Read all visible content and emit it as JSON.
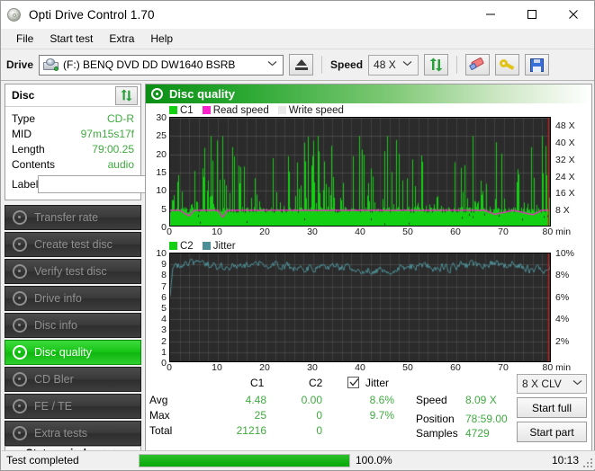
{
  "window": {
    "title": "Opti Drive Control 1.70",
    "icon": "disc-icon",
    "minimize_label": "–",
    "maximize_label": "□",
    "close_label": "✕"
  },
  "menu": {
    "items": [
      {
        "label": "File"
      },
      {
        "label": "Start test"
      },
      {
        "label": "Extra"
      },
      {
        "label": "Help"
      }
    ]
  },
  "toolbar": {
    "drive_label": "Drive",
    "drive_value": "(F:)   BENQ DVD DD DW1640 BSRB",
    "eject_icon": "eject-icon",
    "speed_label": "Speed",
    "speed_value": "48 X",
    "refresh_icon": "refresh-icon",
    "erase_icon": "eraser-icon",
    "key_icon": "key-icon",
    "save_icon": "save-icon"
  },
  "disc_panel": {
    "title": "Disc",
    "refresh_icon": "refresh-icon",
    "rows": [
      {
        "key": "Type",
        "value": "CD-R"
      },
      {
        "key": "MID",
        "value": "97m15s17f"
      },
      {
        "key": "Length",
        "value": "79:00.25"
      },
      {
        "key": "Contents",
        "value": "audio"
      }
    ],
    "label_key": "Label",
    "label_value": "",
    "label_placeholder": "",
    "label_button_icon": "disc-icon"
  },
  "nav": {
    "items": [
      {
        "label": "Transfer rate",
        "icon": "disc-icon",
        "active": false
      },
      {
        "label": "Create test disc",
        "icon": "disc-write-icon",
        "active": false
      },
      {
        "label": "Verify test disc",
        "icon": "disc-check-icon",
        "active": false
      },
      {
        "label": "Drive info",
        "icon": "drive-info-icon",
        "active": false
      },
      {
        "label": "Disc info",
        "icon": "disc-info-icon",
        "active": false
      },
      {
        "label": "Disc quality",
        "icon": "disc-quality-icon",
        "active": true
      },
      {
        "label": "CD Bler",
        "icon": "disc-icon",
        "active": false
      },
      {
        "label": "FE / TE",
        "icon": "disc-icon",
        "active": false
      },
      {
        "label": "Extra tests",
        "icon": "disc-icon",
        "active": false
      }
    ],
    "status_window_label": "Status window > >"
  },
  "content": {
    "header_title": "Disc quality",
    "header_icon": "disc-quality-icon"
  },
  "colors": {
    "c1": "#13d013",
    "c2": "#13d013",
    "read_speed": "#ff22cc",
    "write_speed": "#e6e6e6",
    "jitter": "#4d8f96",
    "accent_green": "#3faa3f",
    "plot_bg": "#2b2b2b",
    "position_marker": "#d02020"
  },
  "chart_data": [
    {
      "type": "area",
      "id": "c1-chart",
      "title": "",
      "legend": [
        {
          "label": "C1",
          "color": "#13d013"
        },
        {
          "label": "Read speed",
          "color": "#ff22cc"
        },
        {
          "label": "Write speed",
          "color": "#e6e6e6"
        }
      ],
      "legend_position": "top-left",
      "grid": true,
      "xlabel": "min",
      "ylabel": "",
      "xlim": [
        0,
        80
      ],
      "ylim": [
        0,
        30
      ],
      "xticks": [
        0,
        10,
        20,
        30,
        40,
        50,
        60,
        70,
        80
      ],
      "xticklabels": [
        "0",
        "10",
        "20",
        "30",
        "40",
        "50",
        "60",
        "70",
        "80 min"
      ],
      "yticks": [
        0,
        5,
        10,
        15,
        20,
        25,
        30
      ],
      "yticklabels": [
        "0",
        "5",
        "10",
        "15",
        "20",
        "25",
        "30"
      ],
      "y2lim": [
        0,
        52
      ],
      "y2ticks": [
        8,
        16,
        24,
        32,
        40,
        48
      ],
      "y2ticklabels": [
        "8 X",
        "16 X",
        "24 X",
        "32 X",
        "40 X",
        "48 X"
      ],
      "series": [
        {
          "name": "C1",
          "color": "#13d013",
          "kind": "impulse-area",
          "baseline": 4.0,
          "mean": 4.48,
          "max": 25,
          "total": 21216,
          "seed": 1640,
          "spike_density": 0.42
        },
        {
          "name": "Read speed",
          "color": "#ff22cc",
          "kind": "line",
          "axis": "y2",
          "values_x": [
            0,
            2,
            4,
            5,
            10,
            11,
            12,
            20,
            30,
            40,
            50,
            60,
            66,
            68,
            72,
            76,
            78,
            79,
            80
          ],
          "values_y": [
            8.1,
            8.1,
            5.4,
            8.1,
            8.1,
            4.8,
            8.1,
            8.1,
            8.1,
            8.1,
            8.1,
            8.1,
            8.1,
            6.2,
            8.1,
            6.0,
            8.1,
            8.1,
            8.1
          ]
        }
      ]
    },
    {
      "type": "line",
      "id": "c2-jitter-chart",
      "title": "",
      "legend": [
        {
          "label": "C2",
          "color": "#13d013"
        },
        {
          "label": "Jitter",
          "color": "#4d8f96"
        }
      ],
      "legend_position": "top-left",
      "grid": true,
      "xlabel": "min",
      "ylabel": "",
      "xlim": [
        0,
        80
      ],
      "ylim": [
        0,
        10
      ],
      "xticks": [
        0,
        10,
        20,
        30,
        40,
        50,
        60,
        70,
        80
      ],
      "xticklabels": [
        "0",
        "10",
        "20",
        "30",
        "40",
        "50",
        "60",
        "70",
        "80 min"
      ],
      "yticks": [
        0,
        1,
        2,
        3,
        4,
        5,
        6,
        7,
        8,
        9,
        10
      ],
      "yticklabels": [
        "0",
        "1",
        "2",
        "3",
        "4",
        "5",
        "6",
        "7",
        "8",
        "9",
        "10"
      ],
      "y2lim": [
        0,
        10
      ],
      "y2ticks": [
        2,
        4,
        6,
        8,
        10
      ],
      "y2ticklabels": [
        "2%",
        "4%",
        "6%",
        "8%",
        "10%"
      ],
      "series": [
        {
          "name": "C2",
          "color": "#13d013",
          "kind": "impulse",
          "values_x": [],
          "values_y": []
        },
        {
          "name": "Jitter",
          "color": "#4d8f96",
          "kind": "line",
          "axis": "y2",
          "avg": 8.6,
          "max": 9.7,
          "mean_level": 8.8,
          "noise": 0.45,
          "seed": 4729
        }
      ]
    }
  ],
  "stats": {
    "col_headers": [
      "C1",
      "C2"
    ],
    "rows": [
      {
        "label": "Avg",
        "c1": "4.48",
        "c2": "0.00",
        "jitter": "8.6%"
      },
      {
        "label": "Max",
        "c1": "25",
        "c2": "0",
        "jitter": "9.7%"
      },
      {
        "label": "Total",
        "c1": "21216",
        "c2": "0",
        "jitter": ""
      }
    ],
    "jitter_label": "Jitter",
    "jitter_checked": true,
    "speed_label": "Speed",
    "speed_value": "8.09 X",
    "position_label": "Position",
    "position_value": "78:59.00",
    "samples_label": "Samples",
    "samples_value": "4729",
    "clv_value": "8 X CLV",
    "start_full_label": "Start full",
    "start_part_label": "Start part"
  },
  "statusbar": {
    "message": "Test completed",
    "progress_percent": 100.0,
    "progress_text": "100.0%",
    "time": "10:13"
  }
}
